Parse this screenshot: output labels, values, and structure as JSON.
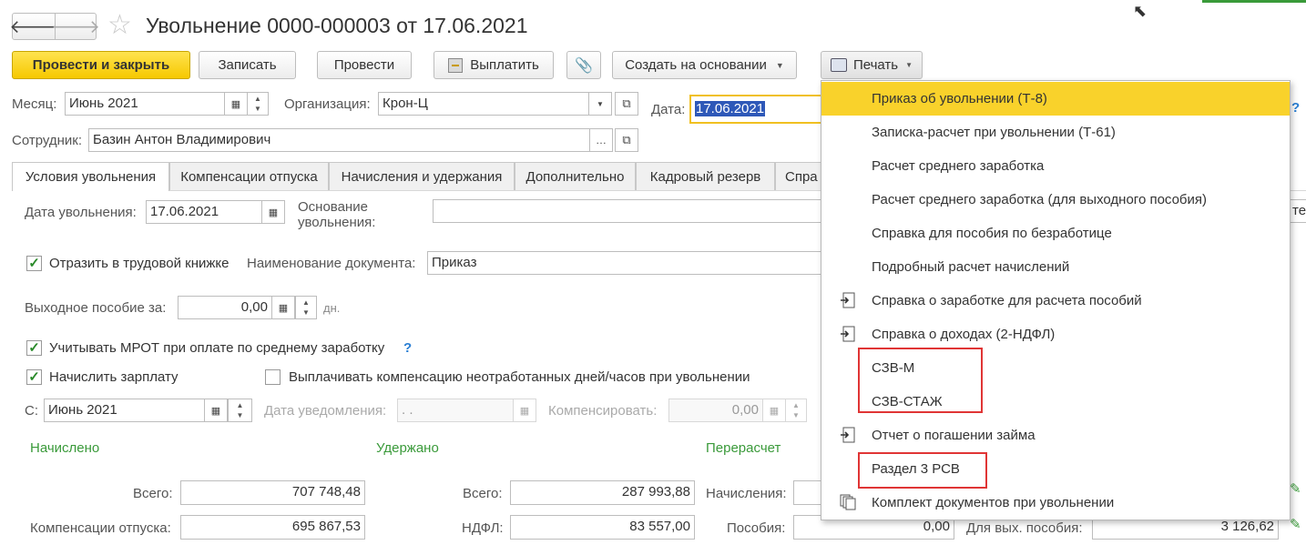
{
  "title": "Увольнение 0000-000003 от 17.06.2021",
  "toolbar": {
    "post_close": "Провести и закрыть",
    "save": "Записать",
    "post": "Провести",
    "pay": "Выплатить",
    "create_based": "Создать на основании",
    "print": "Печать"
  },
  "header": {
    "month_label": "Месяц:",
    "month_value": "Июнь 2021",
    "org_label": "Организация:",
    "org_value": "Крон-Ц",
    "date_label": "Дата:",
    "date_value": "17.06.2021",
    "employee_label": "Сотрудник:",
    "employee_value": "Базин Антон Владимирович",
    "help": "?"
  },
  "tabs": [
    "Условия увольнения",
    "Компенсации отпуска",
    "Начисления и удержания",
    "Дополнительно",
    "Кадровый резерв",
    "Спра"
  ],
  "form": {
    "dismissal_date_label": "Дата увольнения:",
    "dismissal_date_value": "17.06.2021",
    "reason_label": "Основание увольнения:",
    "reason_tail": "те",
    "reflect_label": "Отразить в трудовой книжке",
    "reflect_checked": true,
    "doc_name_label": "Наименование документа:",
    "doc_name_value": "Приказ",
    "severance_label": "Выходное пособие за:",
    "severance_value": "0,00",
    "severance_unit": "дн.",
    "mrot_label": "Учитывать МРОТ при оплате по среднему заработку",
    "mrot_checked": true,
    "mrot_help": "?",
    "accrue_label": "Начислить зарплату",
    "accrue_checked": true,
    "comp_days_label": "Выплачивать компенсацию неотработанных дней/часов при увольнении",
    "comp_days_checked": false,
    "from_label": "С:",
    "from_value": "Июнь 2021",
    "notice_label": "Дата уведомления:",
    "notice_value": " .  .",
    "compensate_label": "Компенсировать:",
    "compensate_value": "0,00"
  },
  "totals": {
    "accrued_header": "Начислено",
    "withheld_header": "Удержано",
    "recalc_header": "Перерасчет",
    "total_label": "Всего:",
    "accrued_total": "707 748,48",
    "withheld_total_label": "Всего:",
    "withheld_total": "287 993,88",
    "accruals_label": "Начисления:",
    "vac_comp_label": "Компенсации отпуска:",
    "vac_comp_value": "695 867,53",
    "ndfl_label": "НДФЛ:",
    "ndfl_value": "83 557,00",
    "benefits_label": "Пособия:",
    "benefits_value": "0,00",
    "severance_pay_label": "Для вых. пособия:",
    "severance_pay_value": "3 126,62"
  },
  "print_menu": [
    {
      "label": "Приказ об увольнении (Т-8)",
      "icon": "",
      "selected": true
    },
    {
      "label": "Записка-расчет при увольнении (Т-61)",
      "icon": ""
    },
    {
      "label": "Расчет среднего заработка",
      "icon": ""
    },
    {
      "label": "Расчет среднего заработка (для выходного пособия)",
      "icon": ""
    },
    {
      "label": "Справка для пособия по безработице",
      "icon": ""
    },
    {
      "label": "Подробный расчет начислений",
      "icon": ""
    },
    {
      "label": "Справка о заработке для расчета пособий",
      "icon": "document-arrow-icon"
    },
    {
      "label": "Справка о доходах (2-НДФЛ)",
      "icon": "document-arrow-icon"
    },
    {
      "label": "СЗВ-М",
      "icon": ""
    },
    {
      "label": "СЗВ-СТАЖ",
      "icon": ""
    },
    {
      "label": "Отчет о погашении займа",
      "icon": "document-arrow-icon"
    },
    {
      "label": "Раздел 3 РСВ",
      "icon": ""
    },
    {
      "label": "Комплект документов при увольнении",
      "icon": "document-set-icon"
    }
  ],
  "colors": {
    "primary": "#f6c800",
    "menu_selected": "#f9d22b",
    "highlight_box": "#e03535",
    "section_header": "#3a9a3a"
  }
}
